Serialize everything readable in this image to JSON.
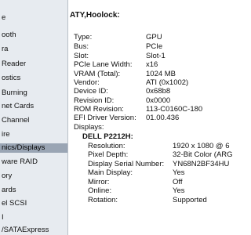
{
  "sidebar": {
    "items": [
      {
        "label": "e"
      },
      {
        "label": "ooth"
      },
      {
        "label": "ra"
      },
      {
        "label": "Reader"
      },
      {
        "label": "ostics"
      },
      {
        "label": "Burning"
      },
      {
        "label": "net Cards"
      },
      {
        "label": "Channel"
      },
      {
        "label": "ire"
      },
      {
        "label": "nics/Displays",
        "selected": true
      },
      {
        "label": "ware RAID"
      },
      {
        "label": "ory"
      },
      {
        "label": "ards"
      },
      {
        "label": "el SCSI"
      },
      {
        "label": "I"
      },
      {
        "label": "/SATAExpress"
      }
    ]
  },
  "main": {
    "title": "ATY,Hoolock:",
    "properties": [
      {
        "label": "Type:",
        "value": "GPU"
      },
      {
        "label": "Bus:",
        "value": "PCIe"
      },
      {
        "label": "Slot:",
        "value": "Slot-1"
      },
      {
        "label": "PCIe Lane Width:",
        "value": "x16"
      },
      {
        "label": "VRAM (Total):",
        "value": "1024 MB"
      },
      {
        "label": "Vendor:",
        "value": "ATI (0x1002)"
      },
      {
        "label": "Device ID:",
        "value": "0x68b8"
      },
      {
        "label": "Revision ID:",
        "value": "0x0000"
      },
      {
        "label": "ROM Revision:",
        "value": "113-C0160C-180"
      },
      {
        "label": "EFI Driver Version:",
        "value": "01.00.436"
      }
    ],
    "displays_heading": "Displays:",
    "monitor_name": "DELL P2212H:",
    "display_properties": [
      {
        "label": "Resolution:",
        "value": "1920 x 1080 @ 6"
      },
      {
        "label": "Pixel Depth:",
        "value": "32-Bit Color (ARG"
      },
      {
        "label": "Display Serial Number:",
        "value": "YN68N2BF34HU"
      },
      {
        "label": "Main Display:",
        "value": "Yes"
      },
      {
        "label": "Mirror:",
        "value": "Off"
      },
      {
        "label": "Online:",
        "value": "Yes"
      },
      {
        "label": "Rotation:",
        "value": "Supported"
      }
    ]
  }
}
